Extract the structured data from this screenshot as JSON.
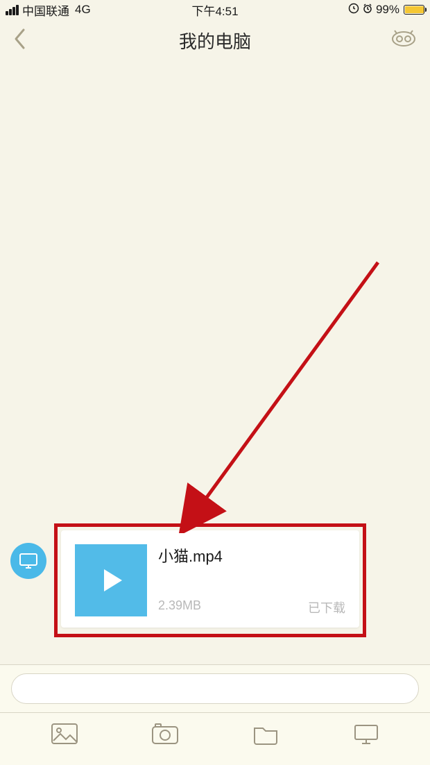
{
  "status": {
    "carrier": "中国联通",
    "network": "4G",
    "time": "下午4:51",
    "battery_pct": "99%"
  },
  "nav": {
    "title": "我的电脑"
  },
  "message": {
    "filename": "小猫.mp4",
    "filesize": "2.39MB",
    "status": "已下载"
  },
  "icons": {
    "back": "back-chevron",
    "menu": "face-menu",
    "avatar": "computer-monitor",
    "play": "play-triangle",
    "tool_image": "image-icon",
    "tool_camera": "camera-icon",
    "tool_folder": "folder-icon",
    "tool_computer": "computer-icon"
  }
}
